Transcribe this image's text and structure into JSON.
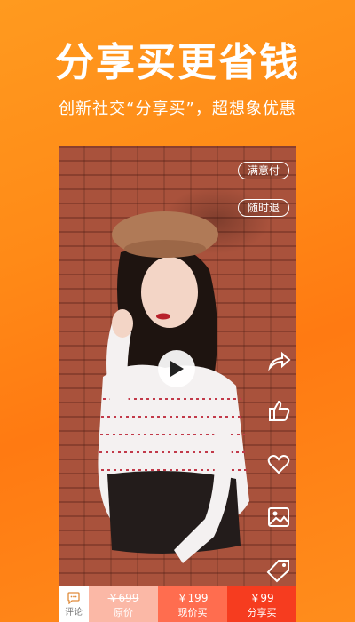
{
  "header": {
    "title": "分享买更省钱",
    "subtitle": "创新社交“分享买”，超想象优惠"
  },
  "video": {
    "badge_satisfied": "满意付",
    "badge_return": "随时退"
  },
  "side_icons": [
    "share-icon",
    "like-icon",
    "heart-icon",
    "image-icon",
    "tag-icon"
  ],
  "bottom_bar": {
    "comment_label": "评论",
    "original_price": "￥699",
    "original_label": "原价",
    "current_price": "￥199",
    "current_label": "现价买",
    "share_price": "￥99",
    "share_label": "分享买"
  },
  "colors": {
    "background": "#ff8a17",
    "original_bg": "#fbb8a6",
    "current_bg": "#ff6d4f",
    "share_bg": "#f63c1f"
  }
}
